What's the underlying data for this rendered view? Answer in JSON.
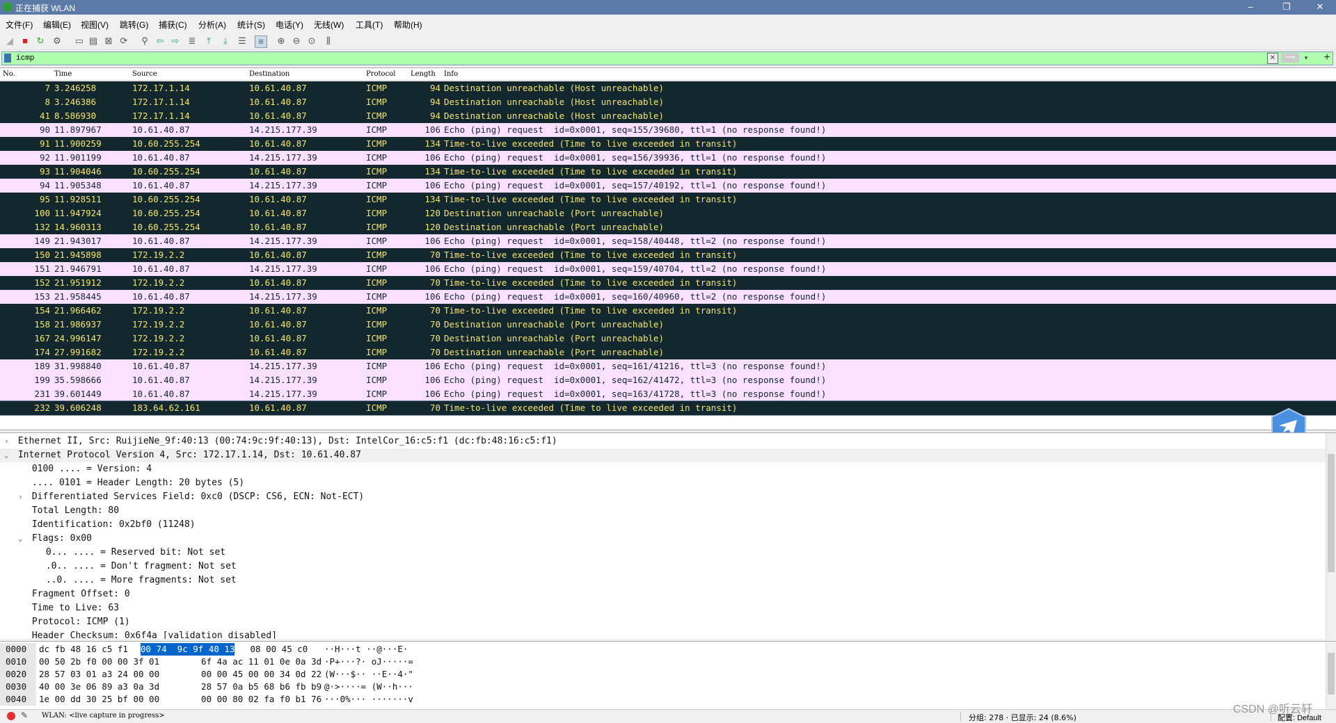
{
  "window": {
    "title": "正在捕获 WLAN",
    "minimize": "–",
    "maximize": "❐",
    "close": "✕"
  },
  "menu": [
    "文件(F)",
    "编辑(E)",
    "视图(V)",
    "跳转(G)",
    "捕获(C)",
    "分析(A)",
    "统计(S)",
    "电话(Y)",
    "无线(W)",
    "工具(T)",
    "帮助(H)"
  ],
  "toolbar_icons": [
    "shark-fin-icon",
    "stop-capture-icon",
    "restart-capture-icon",
    "capture-options-icon",
    "open-file-icon",
    "save-file-icon",
    "close-file-icon",
    "reload-icon",
    "find-packet-icon",
    "go-back-icon",
    "go-forward-icon",
    "go-to-packet-icon",
    "go-first-icon",
    "go-last-icon",
    "auto-scroll-icon",
    "colorize-icon",
    "zoom-in-icon",
    "zoom-out-icon",
    "normal-size-icon",
    "resize-columns-icon"
  ],
  "filter": {
    "value": "icmp",
    "clear_glyph": "✕",
    "apply_glyph": "⟶",
    "dropdown_glyph": "▾",
    "add_glyph": "+"
  },
  "packet_list": {
    "columns": [
      "No.",
      "Time",
      "Source",
      "Destination",
      "Protocol",
      "Length",
      "Info"
    ],
    "rows": [
      {
        "no": "7",
        "time": "3.246258",
        "src": "172.17.1.14",
        "dst": "10.61.40.87",
        "proto": "ICMP",
        "len": "94",
        "info": "Destination unreachable (Host unreachable)",
        "style": "dark"
      },
      {
        "no": "8",
        "time": "3.246386",
        "src": "172.17.1.14",
        "dst": "10.61.40.87",
        "proto": "ICMP",
        "len": "94",
        "info": "Destination unreachable (Host unreachable)",
        "style": "dark"
      },
      {
        "no": "41",
        "time": "8.586930",
        "src": "172.17.1.14",
        "dst": "10.61.40.87",
        "proto": "ICMP",
        "len": "94",
        "info": "Destination unreachable (Host unreachable)",
        "style": "dark"
      },
      {
        "no": "90",
        "time": "11.897967",
        "src": "10.61.40.87",
        "dst": "14.215.177.39",
        "proto": "ICMP",
        "len": "106",
        "info": "Echo (ping) request  id=0x0001, seq=155/39680, ttl=1 (no response found!)",
        "style": "pink"
      },
      {
        "no": "91",
        "time": "11.900259",
        "src": "10.60.255.254",
        "dst": "10.61.40.87",
        "proto": "ICMP",
        "len": "134",
        "info": "Time-to-live exceeded (Time to live exceeded in transit)",
        "style": "dark"
      },
      {
        "no": "92",
        "time": "11.901199",
        "src": "10.61.40.87",
        "dst": "14.215.177.39",
        "proto": "ICMP",
        "len": "106",
        "info": "Echo (ping) request  id=0x0001, seq=156/39936, ttl=1 (no response found!)",
        "style": "pink"
      },
      {
        "no": "93",
        "time": "11.904046",
        "src": "10.60.255.254",
        "dst": "10.61.40.87",
        "proto": "ICMP",
        "len": "134",
        "info": "Time-to-live exceeded (Time to live exceeded in transit)",
        "style": "dark"
      },
      {
        "no": "94",
        "time": "11.905348",
        "src": "10.61.40.87",
        "dst": "14.215.177.39",
        "proto": "ICMP",
        "len": "106",
        "info": "Echo (ping) request  id=0x0001, seq=157/40192, ttl=1 (no response found!)",
        "style": "pink"
      },
      {
        "no": "95",
        "time": "11.928511",
        "src": "10.60.255.254",
        "dst": "10.61.40.87",
        "proto": "ICMP",
        "len": "134",
        "info": "Time-to-live exceeded (Time to live exceeded in transit)",
        "style": "dark"
      },
      {
        "no": "100",
        "time": "11.947924",
        "src": "10.60.255.254",
        "dst": "10.61.40.87",
        "proto": "ICMP",
        "len": "120",
        "info": "Destination unreachable (Port unreachable)",
        "style": "dark"
      },
      {
        "no": "132",
        "time": "14.960313",
        "src": "10.60.255.254",
        "dst": "10.61.40.87",
        "proto": "ICMP",
        "len": "120",
        "info": "Destination unreachable (Port unreachable)",
        "style": "dark"
      },
      {
        "no": "149",
        "time": "21.943017",
        "src": "10.61.40.87",
        "dst": "14.215.177.39",
        "proto": "ICMP",
        "len": "106",
        "info": "Echo (ping) request  id=0x0001, seq=158/40448, ttl=2 (no response found!)",
        "style": "pink"
      },
      {
        "no": "150",
        "time": "21.945898",
        "src": "172.19.2.2",
        "dst": "10.61.40.87",
        "proto": "ICMP",
        "len": "70",
        "info": "Time-to-live exceeded (Time to live exceeded in transit)",
        "style": "dark"
      },
      {
        "no": "151",
        "time": "21.946791",
        "src": "10.61.40.87",
        "dst": "14.215.177.39",
        "proto": "ICMP",
        "len": "106",
        "info": "Echo (ping) request  id=0x0001, seq=159/40704, ttl=2 (no response found!)",
        "style": "pink"
      },
      {
        "no": "152",
        "time": "21.951912",
        "src": "172.19.2.2",
        "dst": "10.61.40.87",
        "proto": "ICMP",
        "len": "70",
        "info": "Time-to-live exceeded (Time to live exceeded in transit)",
        "style": "dark"
      },
      {
        "no": "153",
        "time": "21.958445",
        "src": "10.61.40.87",
        "dst": "14.215.177.39",
        "proto": "ICMP",
        "len": "106",
        "info": "Echo (ping) request  id=0x0001, seq=160/40960, ttl=2 (no response found!)",
        "style": "pink"
      },
      {
        "no": "154",
        "time": "21.966462",
        "src": "172.19.2.2",
        "dst": "10.61.40.87",
        "proto": "ICMP",
        "len": "70",
        "info": "Time-to-live exceeded (Time to live exceeded in transit)",
        "style": "dark"
      },
      {
        "no": "158",
        "time": "21.986937",
        "src": "172.19.2.2",
        "dst": "10.61.40.87",
        "proto": "ICMP",
        "len": "70",
        "info": "Destination unreachable (Port unreachable)",
        "style": "dark"
      },
      {
        "no": "167",
        "time": "24.996147",
        "src": "172.19.2.2",
        "dst": "10.61.40.87",
        "proto": "ICMP",
        "len": "70",
        "info": "Destination unreachable (Port unreachable)",
        "style": "dark"
      },
      {
        "no": "174",
        "time": "27.991682",
        "src": "172.19.2.2",
        "dst": "10.61.40.87",
        "proto": "ICMP",
        "len": "70",
        "info": "Destination unreachable (Port unreachable)",
        "style": "dark"
      },
      {
        "no": "189",
        "time": "31.998840",
        "src": "10.61.40.87",
        "dst": "14.215.177.39",
        "proto": "ICMP",
        "len": "106",
        "info": "Echo (ping) request  id=0x0001, seq=161/41216, ttl=3 (no response found!)",
        "style": "pink"
      },
      {
        "no": "199",
        "time": "35.598666",
        "src": "10.61.40.87",
        "dst": "14.215.177.39",
        "proto": "ICMP",
        "len": "106",
        "info": "Echo (ping) request  id=0x0001, seq=162/41472, ttl=3 (no response found!)",
        "style": "pink"
      },
      {
        "no": "231",
        "time": "39.601449",
        "src": "10.61.40.87",
        "dst": "14.215.177.39",
        "proto": "ICMP",
        "len": "106",
        "info": "Echo (ping) request  id=0x0001, seq=163/41728, ttl=3 (no response found!)",
        "style": "pink"
      },
      {
        "no": "232",
        "time": "39.606248",
        "src": "183.64.62.161",
        "dst": "10.61.40.87",
        "proto": "ICMP",
        "len": "70",
        "info": "Time-to-live exceeded (Time to live exceeded in transit)",
        "style": "sel"
      }
    ]
  },
  "details": [
    {
      "arrow": "›",
      "text": "Ethernet II, Src: RuijieNe_9f:40:13 (00:74:9c:9f:40:13), Dst: IntelCor_16:c5:f1 (dc:fb:48:16:c5:f1)",
      "indent": 0
    },
    {
      "arrow": "⌄",
      "text": "Internet Protocol Version 4, Src: 172.17.1.14, Dst: 10.61.40.87",
      "indent": 0,
      "hl": true
    },
    {
      "arrow": "",
      "text": "0100 .... = Version: 4",
      "indent": 1
    },
    {
      "arrow": "",
      "text": ".... 0101 = Header Length: 20 bytes (5)",
      "indent": 1
    },
    {
      "arrow": "›",
      "text": "Differentiated Services Field: 0xc0 (DSCP: CS6, ECN: Not-ECT)",
      "indent": 1
    },
    {
      "arrow": "",
      "text": "Total Length: 80",
      "indent": 1
    },
    {
      "arrow": "",
      "text": "Identification: 0x2bf0 (11248)",
      "indent": 1
    },
    {
      "arrow": "⌄",
      "text": "Flags: 0x00",
      "indent": 1
    },
    {
      "arrow": "",
      "text": "0... .... = Reserved bit: Not set",
      "indent": 2
    },
    {
      "arrow": "",
      "text": ".0.. .... = Don't fragment: Not set",
      "indent": 2
    },
    {
      "arrow": "",
      "text": "..0. .... = More fragments: Not set",
      "indent": 2
    },
    {
      "arrow": "",
      "text": "Fragment Offset: 0",
      "indent": 1
    },
    {
      "arrow": "",
      "text": "Time to Live: 63",
      "indent": 1
    },
    {
      "arrow": "",
      "text": "Protocol: ICMP (1)",
      "indent": 1
    },
    {
      "arrow": "",
      "text": "Header Checksum: 0x6f4a [validation disabled]",
      "indent": 1
    }
  ],
  "hex": [
    {
      "off": "0000",
      "pre": "dc fb 48 16 c5 f1 ",
      "sel": "00 74  9c 9f 40 13",
      "post": " 08 00 45 c0",
      "ascii": "··H···t ··@···E·"
    },
    {
      "off": "0010",
      "pre": "00 50 2b f0 00 00 3f 01",
      "sel": "",
      "post": "  6f 4a ac 11 01 0e 0a 3d",
      "ascii": "·P+···?· oJ·····="
    },
    {
      "off": "0020",
      "pre": "28 57 03 01 a3 24 00 00",
      "sel": "",
      "post": "  00 00 45 00 00 34 0d 22",
      "ascii": "(W···$·· ··E··4·\""
    },
    {
      "off": "0030",
      "pre": "40 00 3e 06 89 a3 0a 3d",
      "sel": "",
      "post": "  28 57 0a b5 68 b6 fb b9",
      "ascii": "@·>····= (W··h···"
    },
    {
      "off": "0040",
      "pre": "1e 00 dd 30 25 bf 00 00",
      "sel": "",
      "post": "  00 00 80 02 fa f0 b1 76",
      "ascii": "···0%··· ·······v"
    }
  ],
  "status": {
    "capture_text": "WLAN: <live capture in progress>",
    "stats": "分组: 278 · 已显示: 24 (8.6%)",
    "profile": "配置: Default"
  },
  "watermark": "CSDN @听云轩"
}
